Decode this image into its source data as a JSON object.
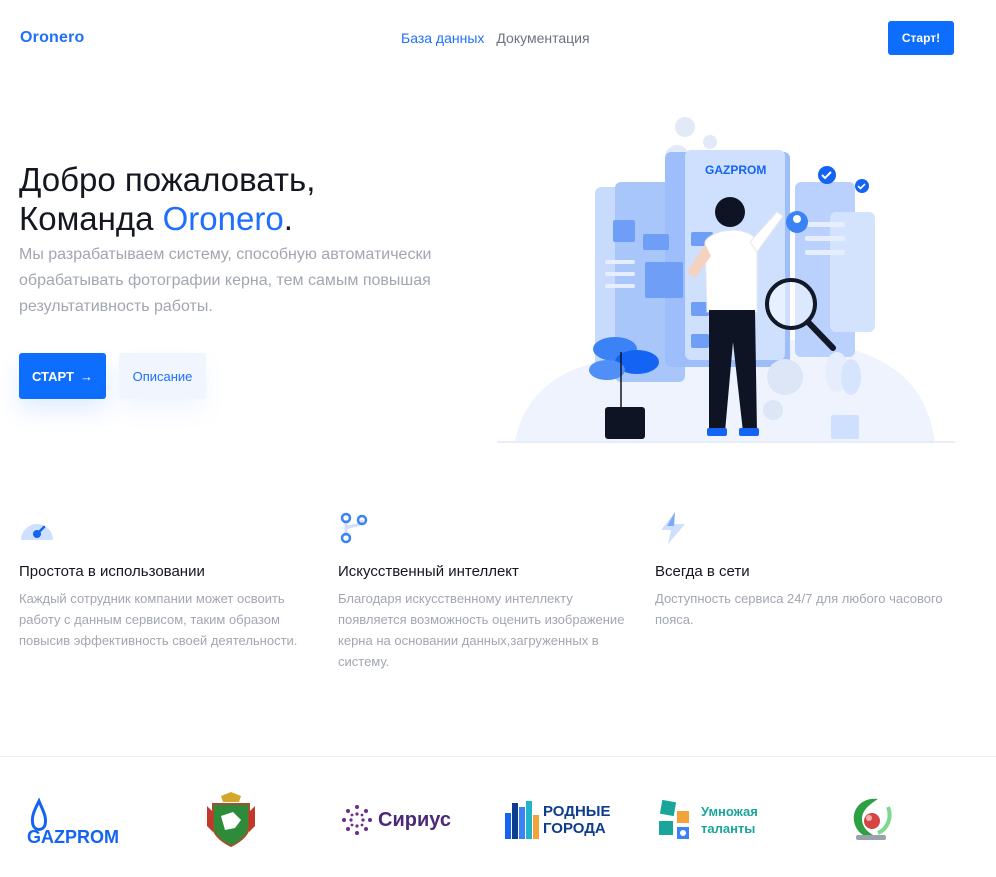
{
  "header": {
    "logo": "Oronero",
    "nav": [
      {
        "label": "База данных"
      },
      {
        "label": "Документация"
      }
    ],
    "start_button": "Старт!"
  },
  "hero": {
    "title_line1": "Добро пожаловать,",
    "title_line2_prefix": "Команда ",
    "title_line2_accent": "Oronero",
    "title_line2_suffix": ".",
    "description": "Мы разрабатываем систему, способную автоматически обрабатывать фотографии керна, тем самым повышая результативность работы.",
    "primary_button": "СТАРТ",
    "primary_button_arrow": "→",
    "secondary_button": "Описание",
    "illustration_brand": "GAZPROM"
  },
  "features": [
    {
      "icon": "gauge-icon",
      "title": "Простота в использовании",
      "text": "Каждый сотрудник компании может освоить работу с данным сервисом, таким образом повысив эффективность своей деятельности."
    },
    {
      "icon": "git-branch-icon",
      "title": "Искусственный интеллект",
      "text": "Благодаря искусственному интеллекту появляется возможность оценить изображение керна на основании данных,загруженных в систему."
    },
    {
      "icon": "lightning-icon",
      "title": "Всегда в сети",
      "text": "Доступность сервиса 24/7 для любого часового пояса."
    }
  ],
  "partners": {
    "gazprom": "GAZPROM",
    "sirius": "Сириус",
    "rodnye_line1": "РОДНЫЕ",
    "rodnye_line2": "ГОРОДА",
    "umnozhaya_line1": "Умножая",
    "umnozhaya_line2": "таланты"
  },
  "colors": {
    "accent": "#1f6fff",
    "button": "#0d6efd",
    "muted_text": "#a2a6b0"
  }
}
